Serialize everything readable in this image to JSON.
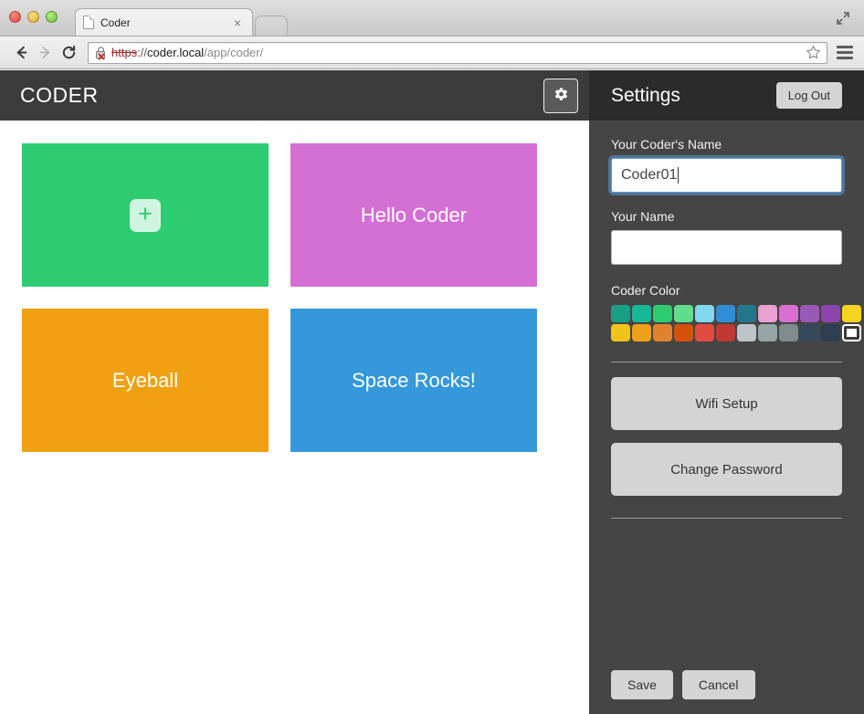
{
  "browser": {
    "tab_title": "Coder",
    "tab_close_label": "×",
    "url": {
      "scheme": "https",
      "separator": "://",
      "host": "coder.local",
      "path": "/app/coder/"
    },
    "back_icon": "back-arrow-icon",
    "forward_icon": "forward-arrow-icon",
    "reload_icon": "reload-icon",
    "security_icon": "insecure-lock-icon",
    "bookmark_icon": "star-icon",
    "menu_icon": "hamburger-menu-icon",
    "expand_icon": "fullscreen-expand-icon"
  },
  "app": {
    "logo": "CODER",
    "gear_icon": "gear-icon",
    "tiles": [
      {
        "label": "",
        "color": "#2ecc71",
        "is_add": true,
        "add_glyph": "+"
      },
      {
        "label": "Hello Coder",
        "color": "#d46fd4",
        "is_add": false
      },
      {
        "label": "Eyeball",
        "color": "#f0a010",
        "is_add": false
      },
      {
        "label": "Space Rocks!",
        "color": "#3498db",
        "is_add": false
      }
    ]
  },
  "settings": {
    "title": "Settings",
    "logout_label": "Log Out",
    "coder_name_label": "Your Coder's Name",
    "coder_name_value": "Coder01",
    "your_name_label": "Your Name",
    "your_name_value": "",
    "color_label": "Coder Color",
    "colors": [
      "#17a085",
      "#18b795",
      "#2ecc71",
      "#5fdd8d",
      "#7fd8ed",
      "#2f8fd6",
      "#22788a",
      "#e9a0d3",
      "#d96fd0",
      "#9b59b6",
      "#8e44ad",
      "#f4d41f",
      "#f0c419",
      "#eda01a",
      "#e0822d",
      "#d4510a",
      "#e24b3f",
      "#c03a32",
      "#bdc3c7",
      "#96a5a6",
      "#7f8c8d",
      "#34495e",
      "#2c3e50",
      "#ffffff"
    ],
    "selected_color_index": 23,
    "wifi_label": "Wifi Setup",
    "password_label": "Change Password",
    "save_label": "Save",
    "cancel_label": "Cancel"
  }
}
